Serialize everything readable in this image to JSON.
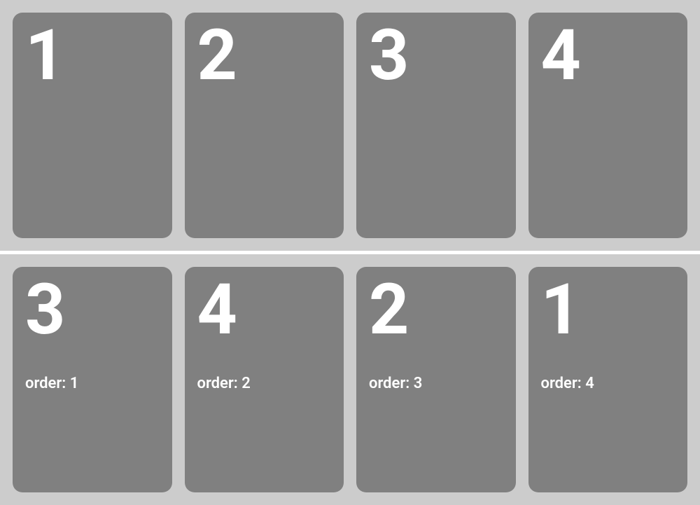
{
  "row1": {
    "cards": [
      {
        "number": "1"
      },
      {
        "number": "2"
      },
      {
        "number": "3"
      },
      {
        "number": "4"
      }
    ]
  },
  "row2": {
    "cards": [
      {
        "number": "3",
        "label": "order: 1"
      },
      {
        "number": "4",
        "label": "order: 2"
      },
      {
        "number": "2",
        "label": "order: 3"
      },
      {
        "number": "1",
        "label": "order: 4"
      }
    ]
  }
}
